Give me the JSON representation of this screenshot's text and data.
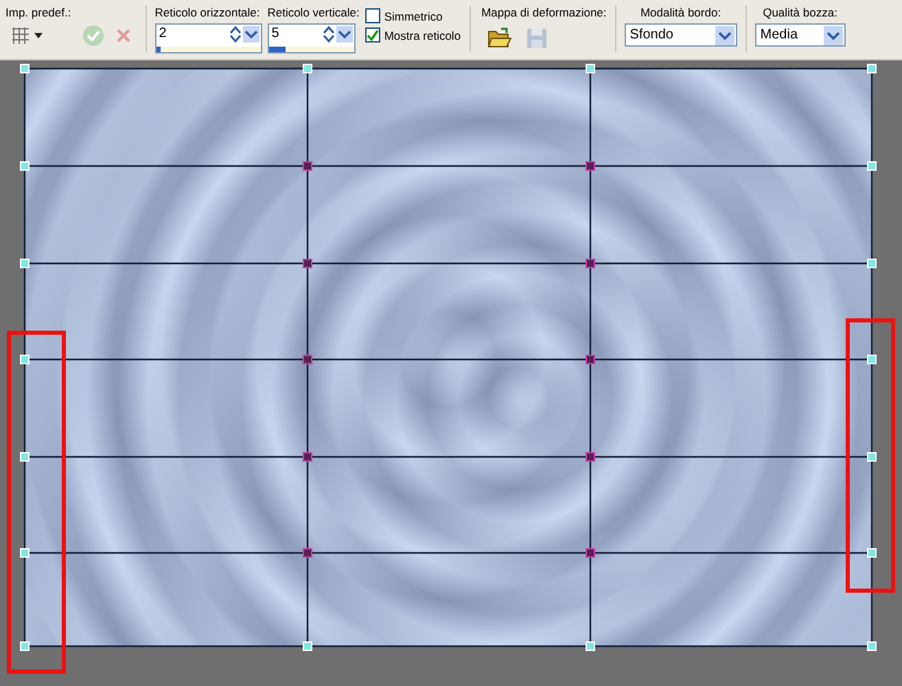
{
  "toolbar": {
    "preset": {
      "label": "Imp. predef.:"
    },
    "horizontal_grid": {
      "label": "Reticolo orizzontale:",
      "value": "2",
      "level": 0.04
    },
    "vertical_grid": {
      "label": "Reticolo verticale:",
      "value": "5",
      "level": 0.2
    },
    "checkboxes": [
      {
        "label": "Simmetrico",
        "checked": false
      },
      {
        "label": "Mostra reticolo",
        "checked": true
      }
    ],
    "deformation_map": {
      "label": "Mappa di deformazione:"
    },
    "edge_mode": {
      "label": "Modalità bordo:",
      "value": "Sfondo"
    },
    "draft_quality": {
      "label": "Qualità bozza:",
      "value": "Media"
    }
  }
}
